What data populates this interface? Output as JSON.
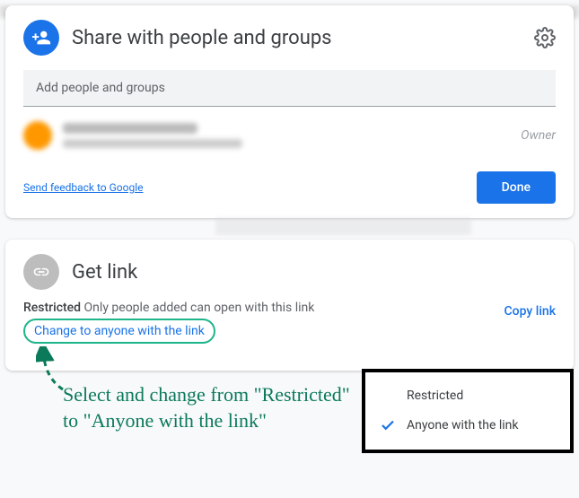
{
  "share": {
    "title": "Share with people and groups",
    "input_placeholder": "Add people and groups",
    "owner_label": "Owner",
    "feedback": "Send feedback to Google",
    "done": "Done"
  },
  "link": {
    "title": "Get link",
    "restricted_label": "Restricted",
    "restricted_desc": "Only people added can open with this link",
    "change": "Change to anyone with the link",
    "copy": "Copy link"
  },
  "dropdown": {
    "restricted": "Restricted",
    "anyone": "Anyone with the link"
  },
  "annotation": {
    "text": "Select and change from \"Restricted\" to \"Anyone with the link\""
  },
  "icons": {
    "person_add": "person-add-icon",
    "gear": "gear-icon",
    "link": "link-icon",
    "check": "check-icon"
  },
  "colors": {
    "primary": "#1a73e8",
    "accent": "#1db58a"
  }
}
